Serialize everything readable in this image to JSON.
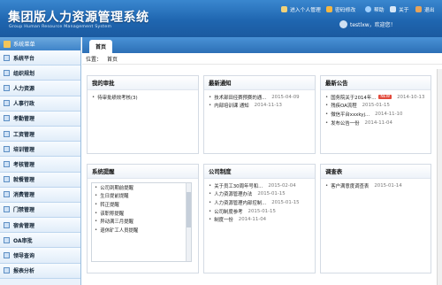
{
  "header": {
    "title": "集团版人力资源管理系统",
    "subtitle": "Group Human Resource Management System",
    "links": [
      {
        "label": "进入个人管理",
        "icon": "person-icon"
      },
      {
        "label": "密码修改",
        "icon": "key-icon"
      },
      {
        "label": "帮助",
        "icon": "help-icon"
      },
      {
        "label": "关于",
        "icon": "about-icon"
      },
      {
        "label": "退出",
        "icon": "exit-icon"
      }
    ],
    "user": "testlxw，欢迎您！"
  },
  "sidebar": {
    "title": "系统菜单",
    "items": [
      "系统平台",
      "组织规划",
      "人力资源",
      "人事行政",
      "考勤管理",
      "工资管理",
      "培训管理",
      "考核管理",
      "就餐管理",
      "消费管理",
      "门禁管理",
      "宿舍管理",
      "OA审批",
      "领导查询",
      "报表分析"
    ]
  },
  "tabs": [
    "首页"
  ],
  "breadcrumb": {
    "label": "位置：",
    "value": "首页"
  },
  "panels": {
    "approval": {
      "title": "我的审批",
      "items": [
        {
          "text": "待审批绩效考核(3)",
          "date": ""
        }
      ]
    },
    "notice": {
      "title": "最新通知",
      "items": [
        {
          "text": "技术部田径赛预赛的通...",
          "date": "2015-04-09"
        },
        {
          "text": "内部培训课 通知",
          "date": "2014-11-13"
        }
      ]
    },
    "announce": {
      "title": "最新公告",
      "items": [
        {
          "text": "国务院关于2014年...",
          "badge": "NEW",
          "date": "2014-10-13"
        },
        {
          "text": "残疾OA流程",
          "date": "2015-01-15"
        },
        {
          "text": "微信平台xxxkyj...",
          "date": "2014-11-10"
        },
        {
          "text": "发布公告一份",
          "date": "2014-11-04"
        }
      ]
    },
    "warning": {
      "title": "系统提醒",
      "items": [
        "公司到期前提醒",
        "生日提前提醒",
        "转正提醒",
        "该职称提醒",
        "异动满三月提醒",
        "退休矿工人员提醒"
      ]
    },
    "policy": {
      "title": "公司制度",
      "items": [
        {
          "text": "关于员工30周年号和...",
          "date": "2015-02-04"
        },
        {
          "text": "人力资源管理办法",
          "date": "2015-01-15"
        },
        {
          "text": "人力资源管理内部控制...",
          "date": "2015-01-15"
        },
        {
          "text": "公司制度参考",
          "date": "2015-01-15"
        },
        {
          "text": "制度一份",
          "date": "2014-11-04"
        }
      ]
    },
    "survey": {
      "title": "调查表",
      "items": [
        {
          "text": "客户满意度调查表",
          "date": "2015-01-14"
        }
      ]
    }
  },
  "colors": {
    "header": "#1f66b0",
    "sidebar": "#eaf2fb",
    "accent": "#e24a3c"
  }
}
